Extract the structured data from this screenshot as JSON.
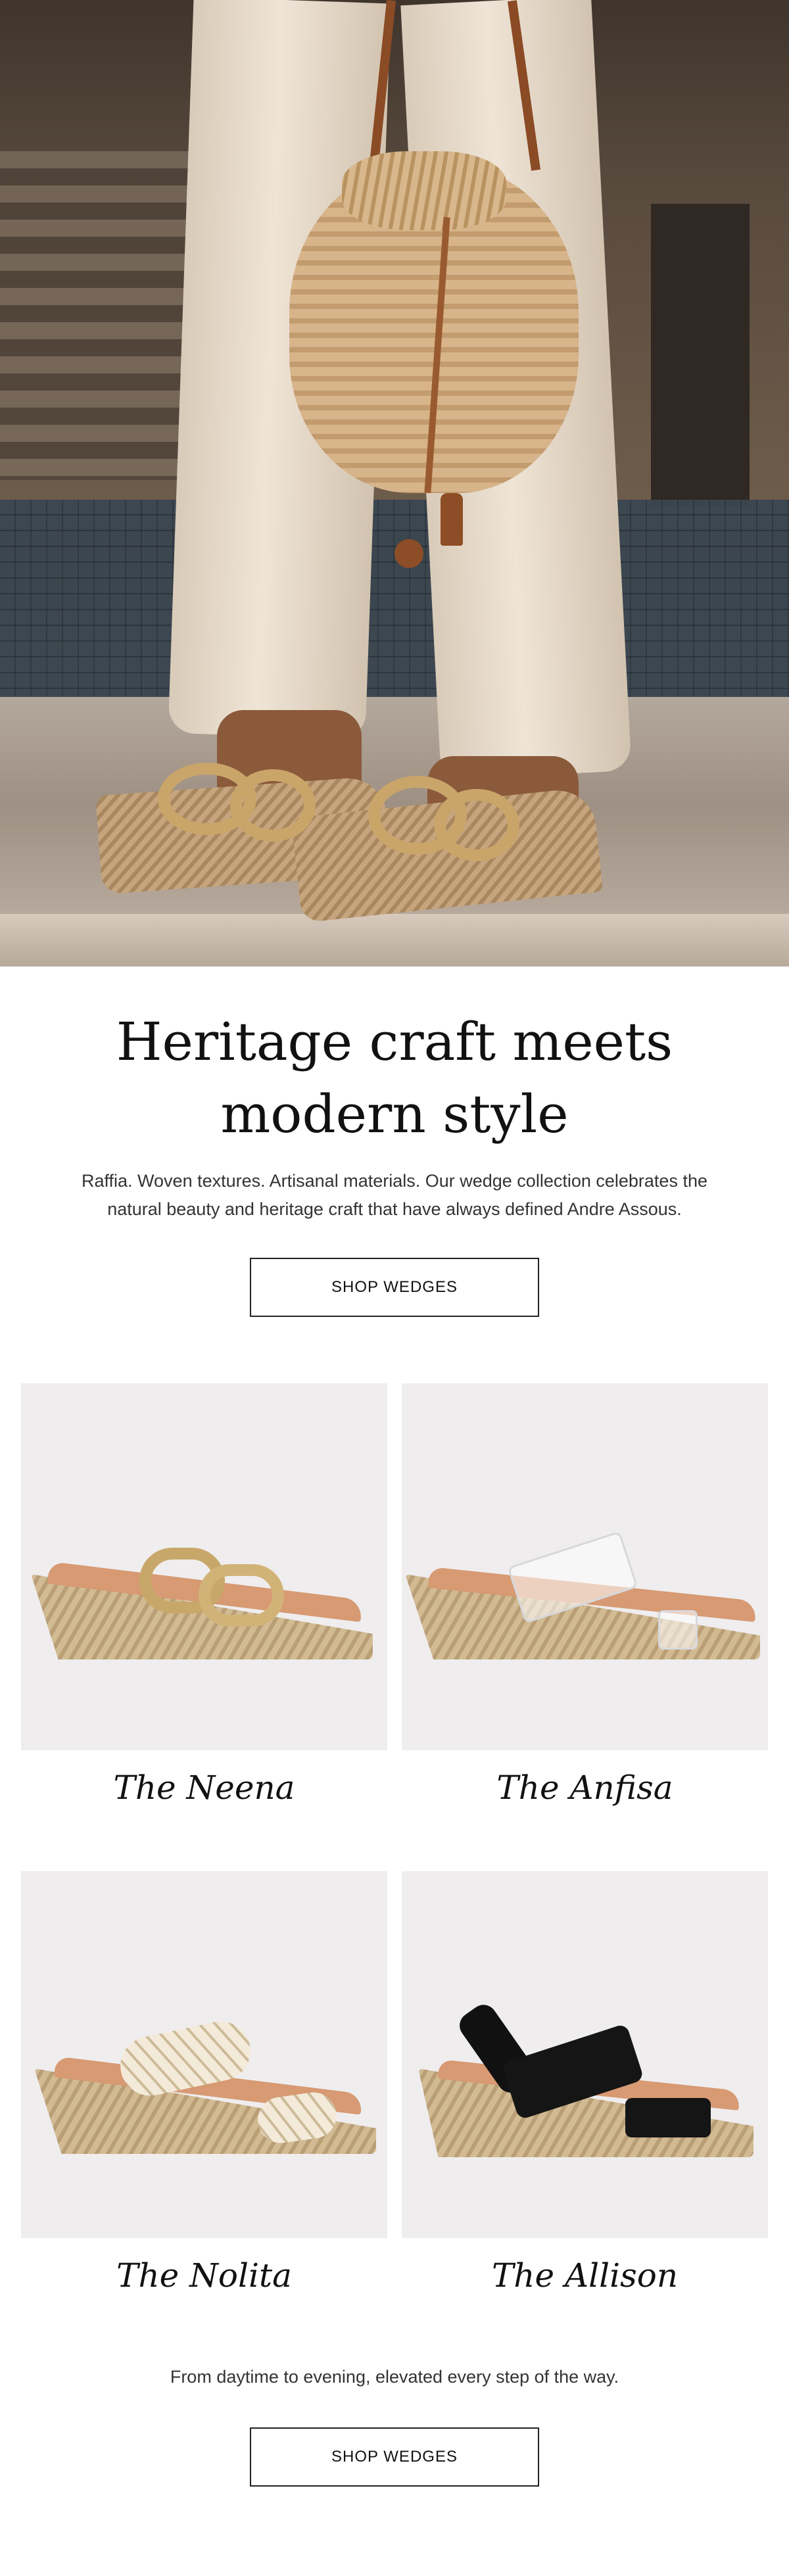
{
  "hero": {
    "image": "woman-wearing-espadrille-wedges-with-raffia-bucket-bag"
  },
  "intro": {
    "headline_line1": "Heritage craft meets",
    "headline_line2": "modern style",
    "body_line1": "Raffia. Woven textures. Artisanal materials. Our wedge collection celebrates the",
    "body_line2": "natural beauty and heritage craft that have always defined Andre Assous.",
    "button_label": "SHOP WEDGES"
  },
  "products": [
    {
      "name": "The Neena",
      "band_color": "#c8a86a"
    },
    {
      "name": "The Anfisa",
      "band_color": "#e6e6e8"
    },
    {
      "name": "The Nolita",
      "band_color": "#efe6d4"
    },
    {
      "name": "The Allison",
      "band_color": "#111111"
    }
  ],
  "footer": {
    "tagline": "From daytime to evening, elevated every step of the way.",
    "button_label": "SHOP WEDGES"
  },
  "colors": {
    "card_bg": "#efedee",
    "text": "#111111",
    "button_border": "#222222"
  }
}
